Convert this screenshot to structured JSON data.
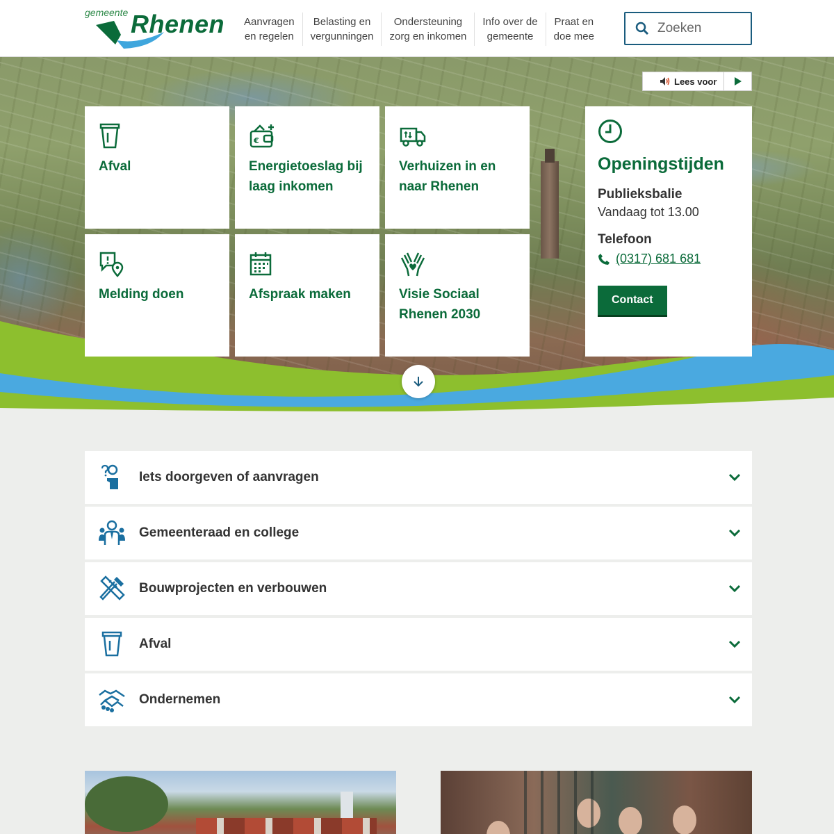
{
  "header": {
    "logo": {
      "small": "gemeente",
      "big": "Rhenen"
    },
    "nav": [
      {
        "line1": "Aanvragen",
        "line2": "en regelen"
      },
      {
        "line1": "Belasting en",
        "line2": "vergunningen"
      },
      {
        "line1": "Ondersteuning",
        "line2": "zorg en inkomen"
      },
      {
        "line1": "Info over de",
        "line2": "gemeente"
      },
      {
        "line1": "Praat en",
        "line2": "doe mee"
      }
    ],
    "search": {
      "placeholder": "Zoeken",
      "icon": "search-icon"
    }
  },
  "readspeaker": {
    "label": "Lees voor",
    "icon": "speaker-icon",
    "play_icon": "play-icon"
  },
  "tiles": [
    {
      "label": "Afval",
      "icon": "waste-bin-icon"
    },
    {
      "label": "Energietoeslag bij laag inkomen",
      "icon": "wallet-euro-icon"
    },
    {
      "label": "Verhuizen in en naar Rhenen",
      "icon": "moving-truck-icon"
    },
    {
      "label": "Melding doen",
      "icon": "report-location-icon"
    },
    {
      "label": "Afspraak maken",
      "icon": "calendar-icon"
    },
    {
      "label": "Visie Sociaal Rhenen 2030",
      "icon": "hands-heart-icon"
    }
  ],
  "hours": {
    "title": "Openingstijden",
    "icon": "clock-icon",
    "counter_title": "Publieksbalie",
    "counter_text": "Vandaag tot 13.00",
    "phone_title": "Telefoon",
    "phone": "(0317) 681 681",
    "contact_button": "Contact"
  },
  "accordion": [
    {
      "label": "Iets doorgeven of aanvragen",
      "icon": "person-request-icon"
    },
    {
      "label": "Gemeenteraad en college",
      "icon": "council-people-icon"
    },
    {
      "label": "Bouwprojecten en verbouwen",
      "icon": "hammer-ruler-icon"
    },
    {
      "label": "Afval",
      "icon": "waste-bin-icon"
    },
    {
      "label": "Ondernemen",
      "icon": "handshake-icon"
    }
  ],
  "colors": {
    "brand_green": "#0b6b3a",
    "accent_blue": "#1a6fa0",
    "wave_green": "#8dbf2e",
    "wave_blue": "#4aa9e0",
    "page_bg": "#edeeec"
  }
}
